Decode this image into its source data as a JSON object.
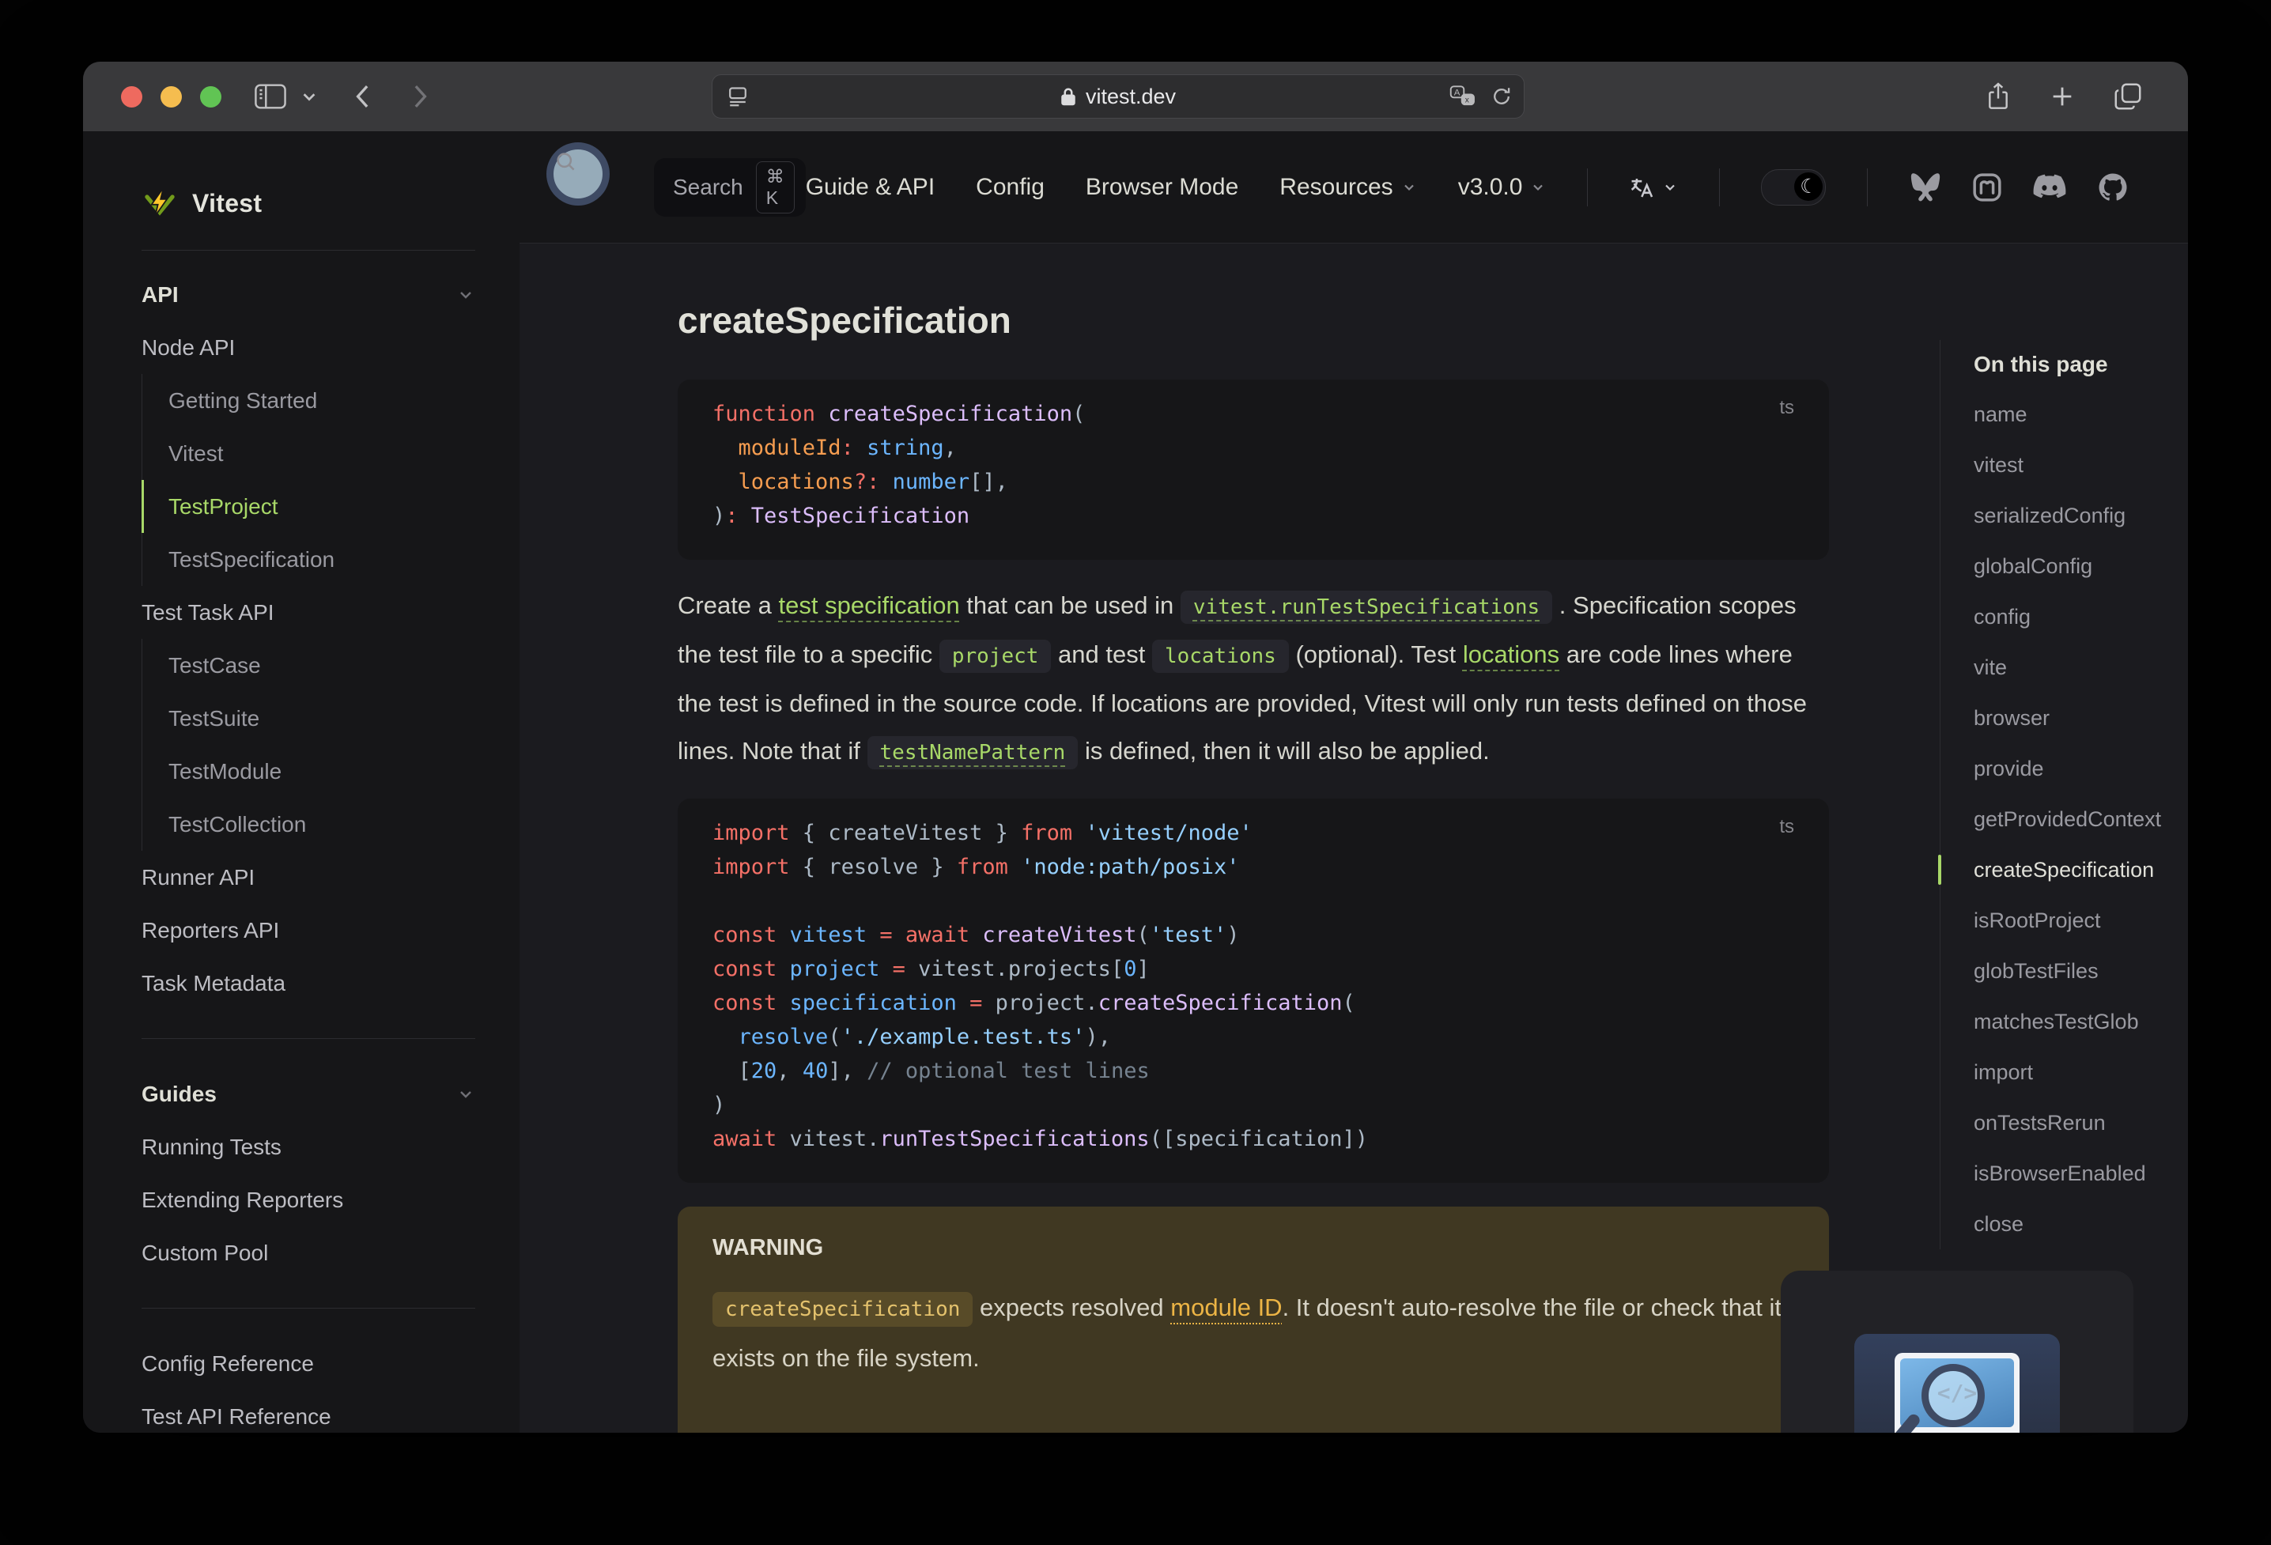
{
  "colors": {
    "brand_green": "#a8d868",
    "warn_bg": "#403822",
    "warn_link": "#ecb445",
    "syntax": {
      "kw": "#f47067",
      "fn": "#dcbdfb",
      "var": "#6cb6ff",
      "typ": "#6cb6ff",
      "str": "#96d0ff",
      "pun": "#adbac7",
      "num": "#6cb6ff",
      "cmt": "#768390",
      "prm": "#f69d50"
    }
  },
  "chrome": {
    "url": "vitest.dev"
  },
  "navbar": {
    "search": {
      "label": "Search",
      "kbd": "⌘ K"
    },
    "items": [
      {
        "label": "Guide & API",
        "chevron": false
      },
      {
        "label": "Config",
        "chevron": false
      },
      {
        "label": "Browser Mode",
        "chevron": false
      },
      {
        "label": "Resources",
        "chevron": true
      },
      {
        "label": "v3.0.0",
        "chevron": true
      }
    ],
    "socials": [
      "bluesky",
      "mastodon",
      "discord",
      "github"
    ]
  },
  "sidebar": {
    "logo_text": "Vitest",
    "rows": [
      {
        "k": "title",
        "label": "API"
      },
      {
        "k": "link",
        "label": "Node API"
      },
      {
        "k": "sub",
        "label": "Getting Started"
      },
      {
        "k": "sub",
        "label": "Vitest"
      },
      {
        "k": "sub",
        "label": "TestProject",
        "active": true
      },
      {
        "k": "sub",
        "label": "TestSpecification"
      },
      {
        "k": "link",
        "label": "Test Task API"
      },
      {
        "k": "sub",
        "label": "TestCase"
      },
      {
        "k": "sub",
        "label": "TestSuite"
      },
      {
        "k": "sub",
        "label": "TestModule"
      },
      {
        "k": "sub",
        "label": "TestCollection"
      },
      {
        "k": "link",
        "label": "Runner API"
      },
      {
        "k": "link",
        "label": "Reporters API"
      },
      {
        "k": "link",
        "label": "Task Metadata"
      },
      {
        "k": "divider"
      },
      {
        "k": "title",
        "label": "Guides"
      },
      {
        "k": "link",
        "label": "Running Tests"
      },
      {
        "k": "link",
        "label": "Extending Reporters"
      },
      {
        "k": "link",
        "label": "Custom Pool"
      },
      {
        "k": "divider"
      },
      {
        "k": "link",
        "label": "Config Reference"
      },
      {
        "k": "link",
        "label": "Test API Reference"
      }
    ]
  },
  "article": {
    "heading": "createSpecification",
    "code1": {
      "lang": "ts",
      "lines": [
        [
          [
            "kw",
            "function "
          ],
          [
            "fn",
            "createSpecification"
          ],
          [
            "pun",
            "("
          ]
        ],
        [
          [
            "prm",
            "  moduleId"
          ],
          [
            "kw",
            ":"
          ],
          [
            "typ",
            " string"
          ],
          [
            "pun",
            ","
          ]
        ],
        [
          [
            "prm",
            "  locations"
          ],
          [
            "kw",
            "?:"
          ],
          [
            "typ",
            " number"
          ],
          [
            "pun",
            "[],"
          ]
        ],
        [
          [
            "pun",
            ")"
          ],
          [
            "kw",
            ":"
          ],
          [
            "fn",
            " TestSpecification"
          ]
        ]
      ]
    },
    "paragraph": [
      {
        "t": "Create a "
      },
      {
        "t": "test specification",
        "k": "link"
      },
      {
        "t": " that can be used in "
      },
      {
        "t": "vitest.runTestSpecifications",
        "k": "chiplink"
      },
      {
        "t": " . Specification scopes the test file to a specific "
      },
      {
        "t": "project",
        "k": "chip"
      },
      {
        "t": " and test "
      },
      {
        "t": "locations",
        "k": "chip"
      },
      {
        "t": " (optional). Test "
      },
      {
        "t": "locations",
        "k": "link"
      },
      {
        "t": " are code lines where the test is defined in the source code. If locations are provided, Vitest will only run tests defined on those lines. Note that if "
      },
      {
        "t": "testNamePattern",
        "k": "chiplink"
      },
      {
        "t": " is defined, then it will also be applied."
      }
    ],
    "code2": {
      "lang": "ts",
      "lines": [
        [
          [
            "kw",
            "import"
          ],
          [
            "pun",
            " { createVitest } "
          ],
          [
            "kw",
            "from"
          ],
          [
            "str",
            " 'vitest/node'"
          ]
        ],
        [
          [
            "kw",
            "import"
          ],
          [
            "pun",
            " { resolve } "
          ],
          [
            "kw",
            "from"
          ],
          [
            "str",
            " 'node:path/posix'"
          ]
        ],
        [],
        [
          [
            "kw",
            "const"
          ],
          [
            "var",
            " vitest"
          ],
          [
            "kw",
            " = "
          ],
          [
            "kw",
            "await"
          ],
          [
            "fn",
            " createVitest"
          ],
          [
            "pun",
            "("
          ],
          [
            "str",
            "'test'"
          ],
          [
            "pun",
            ")"
          ]
        ],
        [
          [
            "kw",
            "const"
          ],
          [
            "var",
            " project"
          ],
          [
            "kw",
            " = "
          ],
          [
            "pun",
            "vitest.projects["
          ],
          [
            "num",
            "0"
          ],
          [
            "pun",
            "]"
          ]
        ],
        [
          [
            "kw",
            "const"
          ],
          [
            "var",
            " specification"
          ],
          [
            "kw",
            " = "
          ],
          [
            "pun",
            "project."
          ],
          [
            "fn",
            "createSpecification"
          ],
          [
            "pun",
            "("
          ]
        ],
        [
          [
            "var",
            "  resolve"
          ],
          [
            "pun",
            "("
          ],
          [
            "str",
            "'./example.test.ts'"
          ],
          [
            "pun",
            "),"
          ]
        ],
        [
          [
            "pun",
            "  ["
          ],
          [
            "num",
            "20"
          ],
          [
            "pun",
            ", "
          ],
          [
            "num",
            "40"
          ],
          [
            "pun",
            "], "
          ],
          [
            "cmt",
            "// optional test lines"
          ]
        ],
        [
          [
            "pun",
            ")"
          ]
        ],
        [
          [
            "kw",
            "await"
          ],
          [
            "pun",
            " vitest."
          ],
          [
            "fn",
            "runTestSpecifications"
          ],
          [
            "pun",
            "(["
          ],
          [
            "pun",
            "specification"
          ],
          [
            "pun",
            "])"
          ]
        ]
      ]
    },
    "warning": {
      "title": "WARNING",
      "runs": [
        {
          "t": "createSpecification",
          "k": "wchip"
        },
        {
          "t": " expects resolved "
        },
        {
          "t": "module ID",
          "k": "wlink"
        },
        {
          "t": ". It doesn't auto-resolve the file or check that it exists on the file system."
        }
      ]
    }
  },
  "toc": {
    "title": "On this page",
    "items": [
      "name",
      "vitest",
      "serializedConfig",
      "globalConfig",
      "config",
      "vite",
      "browser",
      "provide",
      "getProvidedContext",
      "createSpecification",
      "isRootProject",
      "globTestFiles",
      "matchesTestGlob",
      "import",
      "onTestsRerun",
      "isBrowserEnabled",
      "close"
    ],
    "active": "createSpecification"
  },
  "ad": {
    "illustration": "monitor-code-magnifier",
    "screen_code": "</>"
  }
}
